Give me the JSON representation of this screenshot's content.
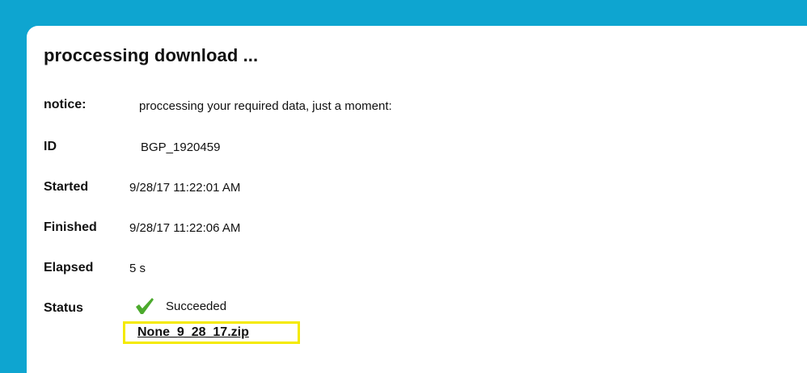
{
  "page": {
    "title": "proccessing download ..."
  },
  "rows": {
    "notice": {
      "label": "notice:",
      "value": "proccessing your required data, just a moment:"
    },
    "id": {
      "label": "ID",
      "value": "BGP_1920459"
    },
    "started": {
      "label": "Started",
      "value": "9/28/17 11:22:01 AM"
    },
    "finished": {
      "label": "Finished",
      "value": "9/28/17 11:22:06 AM"
    },
    "elapsed": {
      "label": "Elapsed",
      "value": "5 s"
    },
    "status": {
      "label": "Status",
      "value": "Succeeded",
      "icon": "checkmark-icon",
      "icon_color": "#4caa2d"
    }
  },
  "download": {
    "filename": "None_9_28_17.zip"
  },
  "colors": {
    "background": "#0ea5d0",
    "panel": "#ffffff",
    "highlight_border": "#f4ea00",
    "text": "#111111"
  }
}
